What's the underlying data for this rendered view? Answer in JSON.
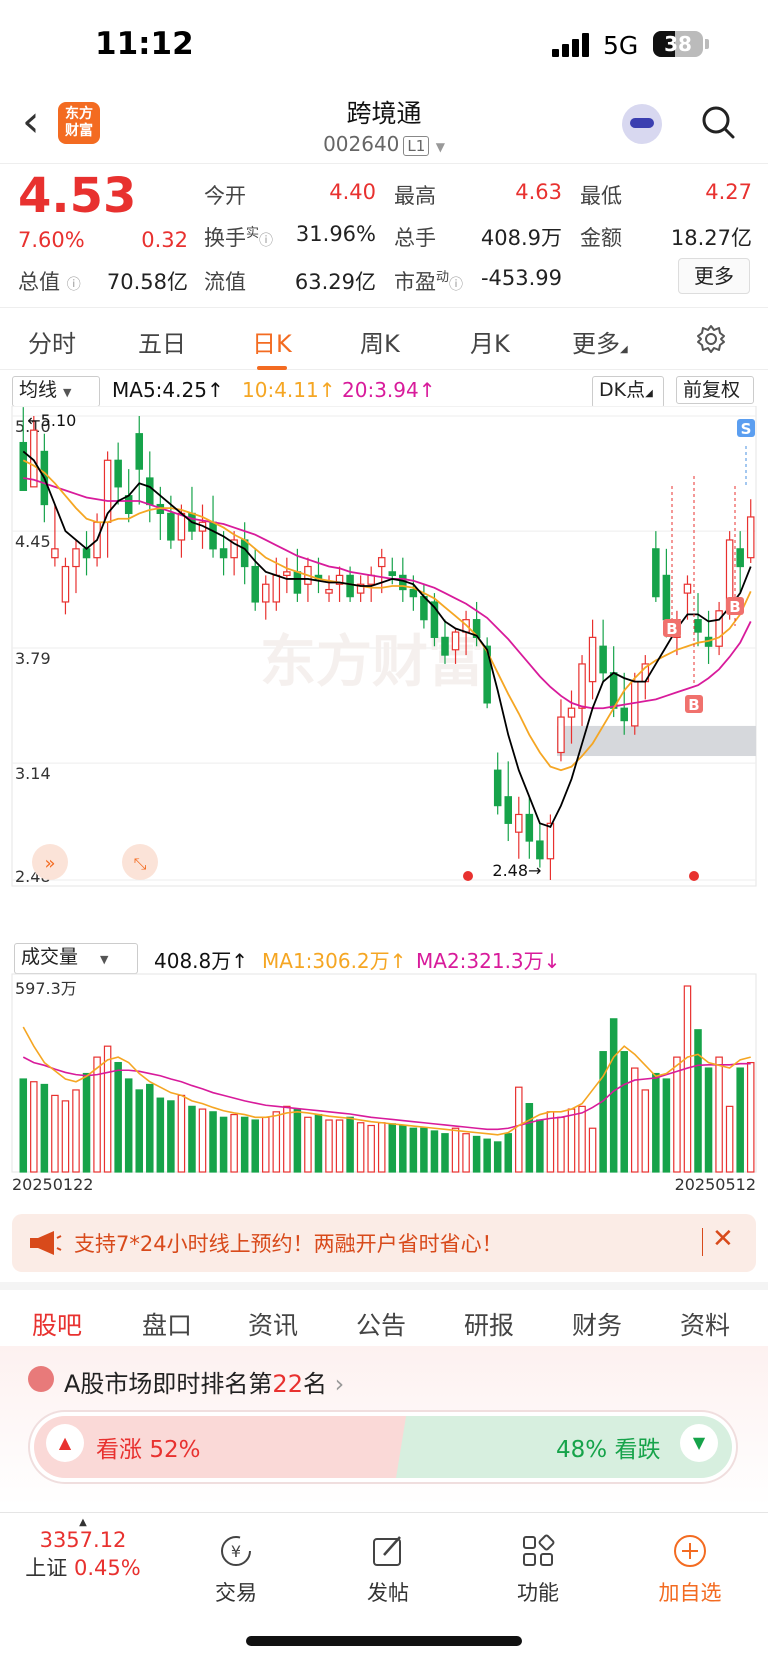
{
  "status": {
    "time": "11:12",
    "network": "5G",
    "battery": "38"
  },
  "nav": {
    "back_icon": "chevron-left-icon",
    "logo_line1": "东方",
    "logo_line2": "财富",
    "title": "跨境通",
    "code": "002640",
    "level": "L1"
  },
  "quote": {
    "price": "4.53",
    "change_pct": "7.60%",
    "change": "0.32",
    "open_label": "今开",
    "open": "4.40",
    "high_label": "最高",
    "high": "4.63",
    "low_label": "最低",
    "low": "4.27",
    "turnover_label": "换手",
    "turnover_sup": "实",
    "turnover": "31.96%",
    "volume_label": "总手",
    "volume": "408.9万",
    "amount_label": "金额",
    "amount": "18.27亿",
    "mktcap_label": "总值",
    "mktcap": "70.58亿",
    "float_label": "流值",
    "float": "63.29亿",
    "pe_label": "市盈",
    "pe_sup": "动",
    "pe": "-453.99",
    "more": "更多"
  },
  "ktabs": [
    {
      "label": "分时",
      "active": false
    },
    {
      "label": "五日",
      "active": false
    },
    {
      "label": "日K",
      "active": true
    },
    {
      "label": "周K",
      "active": false
    },
    {
      "label": "月K",
      "active": false
    },
    {
      "label": "更多",
      "active": false
    }
  ],
  "ma_legend": {
    "select": "均线",
    "ma5": "MA5:4.25",
    "ma10": "10:4.11",
    "ma20": "20:3.94",
    "dk": "DK点",
    "fq": "前复权"
  },
  "chart_data": {
    "type": "candlestick",
    "y_ticks": [
      "5.10",
      "4.45",
      "3.79",
      "3.14",
      "2.48"
    ],
    "ylim": [
      2.48,
      5.1
    ],
    "max_label": "5.10",
    "min_label": "2.48",
    "date_start": "20250122",
    "date_end": "20250512",
    "candles": [
      [
        4.95,
        5.15,
        4.7,
        4.68
      ],
      [
        4.7,
        5.1,
        4.7,
        5.02
      ],
      [
        4.9,
        5.0,
        4.5,
        4.6
      ],
      [
        4.3,
        4.6,
        4.25,
        4.35
      ],
      [
        4.05,
        4.3,
        3.98,
        4.25
      ],
      [
        4.25,
        4.4,
        4.1,
        4.35
      ],
      [
        4.35,
        4.45,
        4.2,
        4.3
      ],
      [
        4.3,
        4.55,
        4.25,
        4.5
      ],
      [
        4.5,
        4.9,
        4.3,
        4.85
      ],
      [
        4.85,
        4.95,
        4.6,
        4.7
      ],
      [
        4.65,
        4.8,
        4.5,
        4.55
      ],
      [
        5.0,
        5.1,
        4.6,
        4.8
      ],
      [
        4.75,
        4.9,
        4.5,
        4.6
      ],
      [
        4.6,
        4.7,
        4.4,
        4.55
      ],
      [
        4.55,
        4.65,
        4.35,
        4.4
      ],
      [
        4.4,
        4.6,
        4.3,
        4.55
      ],
      [
        4.55,
        4.7,
        4.4,
        4.45
      ],
      [
        4.45,
        4.6,
        4.35,
        4.5
      ],
      [
        4.5,
        4.65,
        4.3,
        4.35
      ],
      [
        4.35,
        4.45,
        4.2,
        4.3
      ],
      [
        4.3,
        4.45,
        4.2,
        4.4
      ],
      [
        4.4,
        4.5,
        4.15,
        4.25
      ],
      [
        4.25,
        4.35,
        4.0,
        4.05
      ],
      [
        4.05,
        4.2,
        3.95,
        4.15
      ],
      [
        4.05,
        4.3,
        4.0,
        4.2
      ],
      [
        4.2,
        4.3,
        4.1,
        4.22
      ],
      [
        4.22,
        4.35,
        4.05,
        4.1
      ],
      [
        4.15,
        4.3,
        4.05,
        4.25
      ],
      [
        4.2,
        4.3,
        4.1,
        4.18
      ],
      [
        4.1,
        4.2,
        4.05,
        4.12
      ],
      [
        4.15,
        4.25,
        4.05,
        4.2
      ],
      [
        4.2,
        4.25,
        4.05,
        4.08
      ],
      [
        4.1,
        4.2,
        4.05,
        4.15
      ],
      [
        4.15,
        4.25,
        4.05,
        4.2
      ],
      [
        4.25,
        4.35,
        4.1,
        4.3
      ],
      [
        4.22,
        4.3,
        4.15,
        4.2
      ],
      [
        4.2,
        4.3,
        4.05,
        4.12
      ],
      [
        4.12,
        4.2,
        4.0,
        4.08
      ],
      [
        4.08,
        4.15,
        3.9,
        3.95
      ],
      [
        4.05,
        4.1,
        3.8,
        3.85
      ],
      [
        3.85,
        3.95,
        3.7,
        3.75
      ],
      [
        3.78,
        3.9,
        3.7,
        3.88
      ],
      [
        3.88,
        4.0,
        3.75,
        3.95
      ],
      [
        3.95,
        4.05,
        3.8,
        3.85
      ],
      [
        3.8,
        3.85,
        3.45,
        3.48
      ],
      [
        3.1,
        3.2,
        2.85,
        2.9
      ],
      [
        2.95,
        3.15,
        2.7,
        2.8
      ],
      [
        2.75,
        2.95,
        2.6,
        2.85
      ],
      [
        2.85,
        2.95,
        2.6,
        2.7
      ],
      [
        2.7,
        2.8,
        2.55,
        2.6
      ],
      [
        2.6,
        2.85,
        2.48,
        2.8
      ],
      [
        3.2,
        3.5,
        3.15,
        3.4
      ],
      [
        3.4,
        3.55,
        3.25,
        3.45
      ],
      [
        3.45,
        3.75,
        3.35,
        3.7
      ],
      [
        3.6,
        3.95,
        3.5,
        3.85
      ],
      [
        3.8,
        3.95,
        3.6,
        3.65
      ],
      [
        3.65,
        3.8,
        3.4,
        3.45
      ],
      [
        3.45,
        3.65,
        3.3,
        3.38
      ],
      [
        3.35,
        3.65,
        3.3,
        3.6
      ],
      [
        3.6,
        3.75,
        3.5,
        3.7
      ],
      [
        4.35,
        4.45,
        4.05,
        4.08
      ],
      [
        4.2,
        4.35,
        3.85,
        3.95
      ],
      [
        3.85,
        4.0,
        3.75,
        3.95
      ],
      [
        4.1,
        4.2,
        3.95,
        4.15
      ],
      [
        3.95,
        4.1,
        3.8,
        3.88
      ],
      [
        3.85,
        4.0,
        3.7,
        3.8
      ],
      [
        3.8,
        4.05,
        3.75,
        4.0
      ],
      [
        4.0,
        4.45,
        3.95,
        4.4
      ],
      [
        4.35,
        4.45,
        4.1,
        4.25
      ],
      [
        4.3,
        4.63,
        4.27,
        4.53
      ]
    ],
    "ma5": [
      4.9,
      4.85,
      4.75,
      4.6,
      4.45,
      4.4,
      4.35,
      4.4,
      4.55,
      4.62,
      4.65,
      4.72,
      4.7,
      4.65,
      4.6,
      4.55,
      4.5,
      4.48,
      4.45,
      4.42,
      4.38,
      4.35,
      4.28,
      4.22,
      4.2,
      4.18,
      4.18,
      4.18,
      4.17,
      4.16,
      4.16,
      4.15,
      4.14,
      4.14,
      4.16,
      4.18,
      4.17,
      4.15,
      4.08,
      4.02,
      3.94,
      3.9,
      3.88,
      3.86,
      3.78,
      3.55,
      3.3,
      3.1,
      2.95,
      2.8,
      2.78,
      2.9,
      3.05,
      3.25,
      3.45,
      3.6,
      3.65,
      3.62,
      3.6,
      3.6,
      3.7,
      3.8,
      3.9,
      3.98,
      3.98,
      3.94,
      3.95,
      4.02,
      4.1,
      4.25
    ],
    "ma10": [
      4.85,
      4.82,
      4.78,
      4.72,
      4.65,
      4.58,
      4.52,
      4.5,
      4.5,
      4.52,
      4.52,
      4.55,
      4.57,
      4.58,
      4.58,
      4.57,
      4.55,
      4.53,
      4.5,
      4.47,
      4.43,
      4.4,
      4.35,
      4.3,
      4.27,
      4.24,
      4.22,
      4.2,
      4.18,
      4.17,
      4.16,
      4.15,
      4.14,
      4.13,
      4.13,
      4.14,
      4.14,
      4.13,
      4.1,
      4.07,
      4.02,
      3.97,
      3.92,
      3.86,
      3.77,
      3.65,
      3.53,
      3.42,
      3.3,
      3.2,
      3.12,
      3.1,
      3.12,
      3.18,
      3.25,
      3.35,
      3.45,
      3.55,
      3.62,
      3.68,
      3.72,
      3.75,
      3.78,
      3.8,
      3.82,
      3.83,
      3.85,
      3.9,
      3.98,
      4.11
    ],
    "ma20": [
      4.75,
      4.74,
      4.72,
      4.7,
      4.68,
      4.66,
      4.64,
      4.63,
      4.62,
      4.62,
      4.62,
      4.62,
      4.6,
      4.58,
      4.56,
      4.54,
      4.52,
      4.51,
      4.5,
      4.49,
      4.47,
      4.45,
      4.43,
      4.4,
      4.37,
      4.34,
      4.31,
      4.29,
      4.27,
      4.25,
      4.24,
      4.22,
      4.21,
      4.2,
      4.19,
      4.18,
      4.18,
      4.17,
      4.15,
      4.13,
      4.1,
      4.07,
      4.04,
      4.0,
      3.96,
      3.9,
      3.84,
      3.77,
      3.7,
      3.63,
      3.57,
      3.52,
      3.48,
      3.46,
      3.45,
      3.45,
      3.46,
      3.47,
      3.48,
      3.49,
      3.5,
      3.52,
      3.54,
      3.56,
      3.58,
      3.62,
      3.67,
      3.74,
      3.82,
      3.94
    ],
    "volume_max": "597.3万",
    "volumes": [
      170,
      165,
      160,
      140,
      130,
      150,
      180,
      210,
      230,
      200,
      170,
      150,
      160,
      135,
      130,
      140,
      120,
      115,
      110,
      100,
      105,
      100,
      95,
      100,
      110,
      120,
      115,
      100,
      105,
      95,
      95,
      100,
      90,
      85,
      90,
      88,
      85,
      80,
      80,
      75,
      70,
      80,
      70,
      65,
      60,
      55,
      70,
      155,
      125,
      95,
      110,
      100,
      115,
      120,
      80,
      220,
      280,
      220,
      190,
      150,
      180,
      170,
      210,
      340,
      260,
      190,
      210,
      120,
      190,
      200
    ],
    "ma1": [
      265,
      230,
      200,
      185,
      170,
      165,
      175,
      190,
      205,
      210,
      200,
      180,
      165,
      155,
      145,
      140,
      130,
      125,
      118,
      112,
      108,
      105,
      100,
      100,
      103,
      108,
      110,
      108,
      105,
      102,
      100,
      98,
      95,
      92,
      90,
      88,
      86,
      84,
      82,
      80,
      78,
      76,
      74,
      72,
      70,
      68,
      72,
      85,
      95,
      105,
      110,
      110,
      115,
      125,
      150,
      175,
      210,
      230,
      215,
      195,
      175,
      180,
      195,
      210,
      215,
      200,
      195,
      190,
      205,
      210
    ],
    "ma2": [
      210,
      200,
      195,
      188,
      182,
      178,
      176,
      178,
      182,
      186,
      186,
      184,
      180,
      176,
      170,
      165,
      158,
      152,
      145,
      140,
      135,
      130,
      126,
      122,
      120,
      118,
      116,
      114,
      112,
      110,
      108,
      106,
      103,
      100,
      98,
      96,
      94,
      92,
      90,
      88,
      86,
      84,
      82,
      80,
      78,
      78,
      80,
      85,
      90,
      95,
      98,
      100,
      104,
      108,
      118,
      130,
      148,
      160,
      168,
      170,
      172,
      178,
      184,
      190,
      195,
      196,
      196,
      196,
      198,
      198
    ],
    "vol_legend": {
      "select": "成交量",
      "vol": "408.8万",
      "ma1": "MA1:306.2万",
      "ma2": "MA2:321.3万"
    },
    "colors": {
      "up": "#e8312f",
      "down": "#16a34a",
      "ma5": "#000000",
      "ma10": "#f5a623",
      "ma20": "#d81b9b"
    }
  },
  "banner": {
    "text": "支持7*24小时线上预约！两融开户省时省心！",
    "close": "✕"
  },
  "tabs2": [
    {
      "label": "股吧",
      "active": true
    },
    {
      "label": "盘口",
      "active": false
    },
    {
      "label": "资讯",
      "active": false
    },
    {
      "label": "公告",
      "active": false
    },
    {
      "label": "研报",
      "active": false
    },
    {
      "label": "财务",
      "active": false
    },
    {
      "label": "资料",
      "active": false
    }
  ],
  "rank": {
    "title_pre": "A股市场即时排名第",
    "rank": "22",
    "title_post": "名",
    "up_label": "看涨",
    "up_pct": "52%",
    "down_pct": "48%",
    "down_label": "看跌"
  },
  "bottom": {
    "index_value": "3357.12",
    "index_name": "上证",
    "index_pct": "0.45%",
    "items": [
      {
        "label": "交易",
        "icon": "trade-icon"
      },
      {
        "label": "发帖",
        "icon": "edit-icon"
      },
      {
        "label": "功能",
        "icon": "grid-icon"
      },
      {
        "label": "加自选",
        "icon": "add-circle-icon"
      }
    ]
  }
}
